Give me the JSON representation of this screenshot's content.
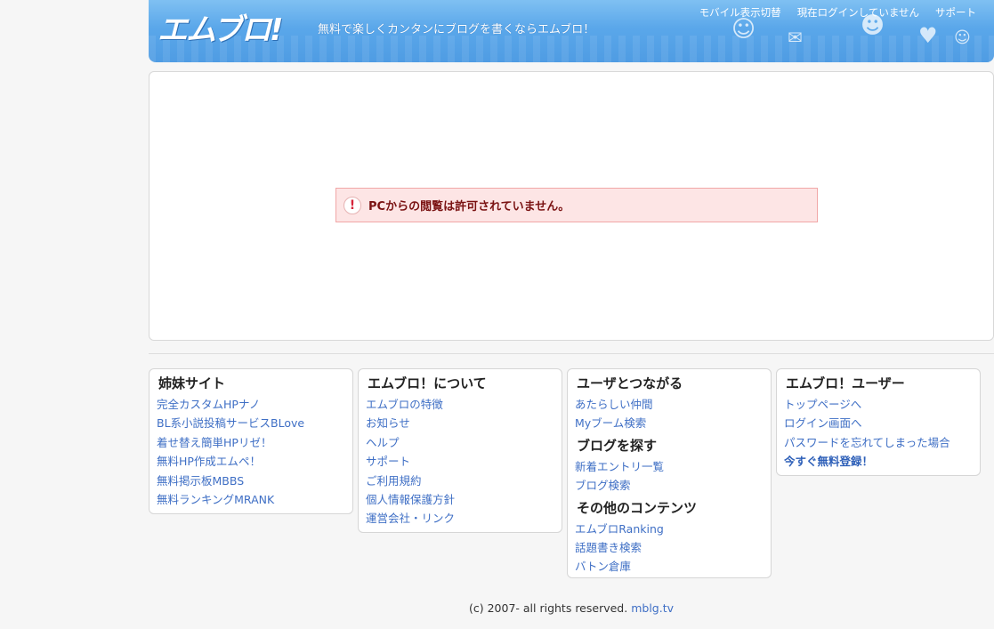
{
  "header": {
    "logo": "エムブロ!",
    "tagline": "無料で楽しくカンタンにブログを書くならエムブロ！",
    "nav": [
      "モバイル表示切替",
      "現在ログインしていません",
      "サポート"
    ]
  },
  "alert": {
    "icon": "!",
    "message": "PCからの閲覧は許可されていません。"
  },
  "sister_sites": {
    "title": "姉妹サイト",
    "links": [
      "完全カスタムHPナノ",
      "BL系小説投稿サービスBLove",
      "着せ替え簡単HPリゼ！",
      "無料HP作成エムペ！",
      "無料掲示板MBBS",
      "無料ランキングMRANK"
    ]
  },
  "about": {
    "title": "エムブロ！について",
    "links": [
      "エムブロの特徴",
      "お知らせ",
      "ヘルプ",
      "サポート",
      "ご利用規約",
      "個人情報保護方針",
      "運営会社・リンク"
    ]
  },
  "connect": {
    "title": "ユーザとつながる",
    "links": [
      "あたらしい仲間",
      "Myブーム検索"
    ],
    "find_title": "ブログを探す",
    "find_links": [
      "新着エントリ一覧",
      "ブログ検索"
    ],
    "other_title": "その他のコンテンツ",
    "other_links": [
      "エムブロRanking",
      "話題書き検索",
      "バトン倉庫"
    ]
  },
  "users": {
    "title": "エムブロ！ユーザー",
    "links": [
      "トップページへ",
      "ログイン画面へ",
      "パスワードを忘れてしまった場合"
    ],
    "register": "今すぐ無料登録！"
  },
  "footer": {
    "copyright": "(c) 2007- all rights reserved.",
    "domain": "mblg.tv"
  },
  "colors": {
    "header_blue": "#5aa7ea",
    "link": "#3f6fc5",
    "alert_bg": "#fde5e5",
    "alert_text": "#7a1212"
  }
}
